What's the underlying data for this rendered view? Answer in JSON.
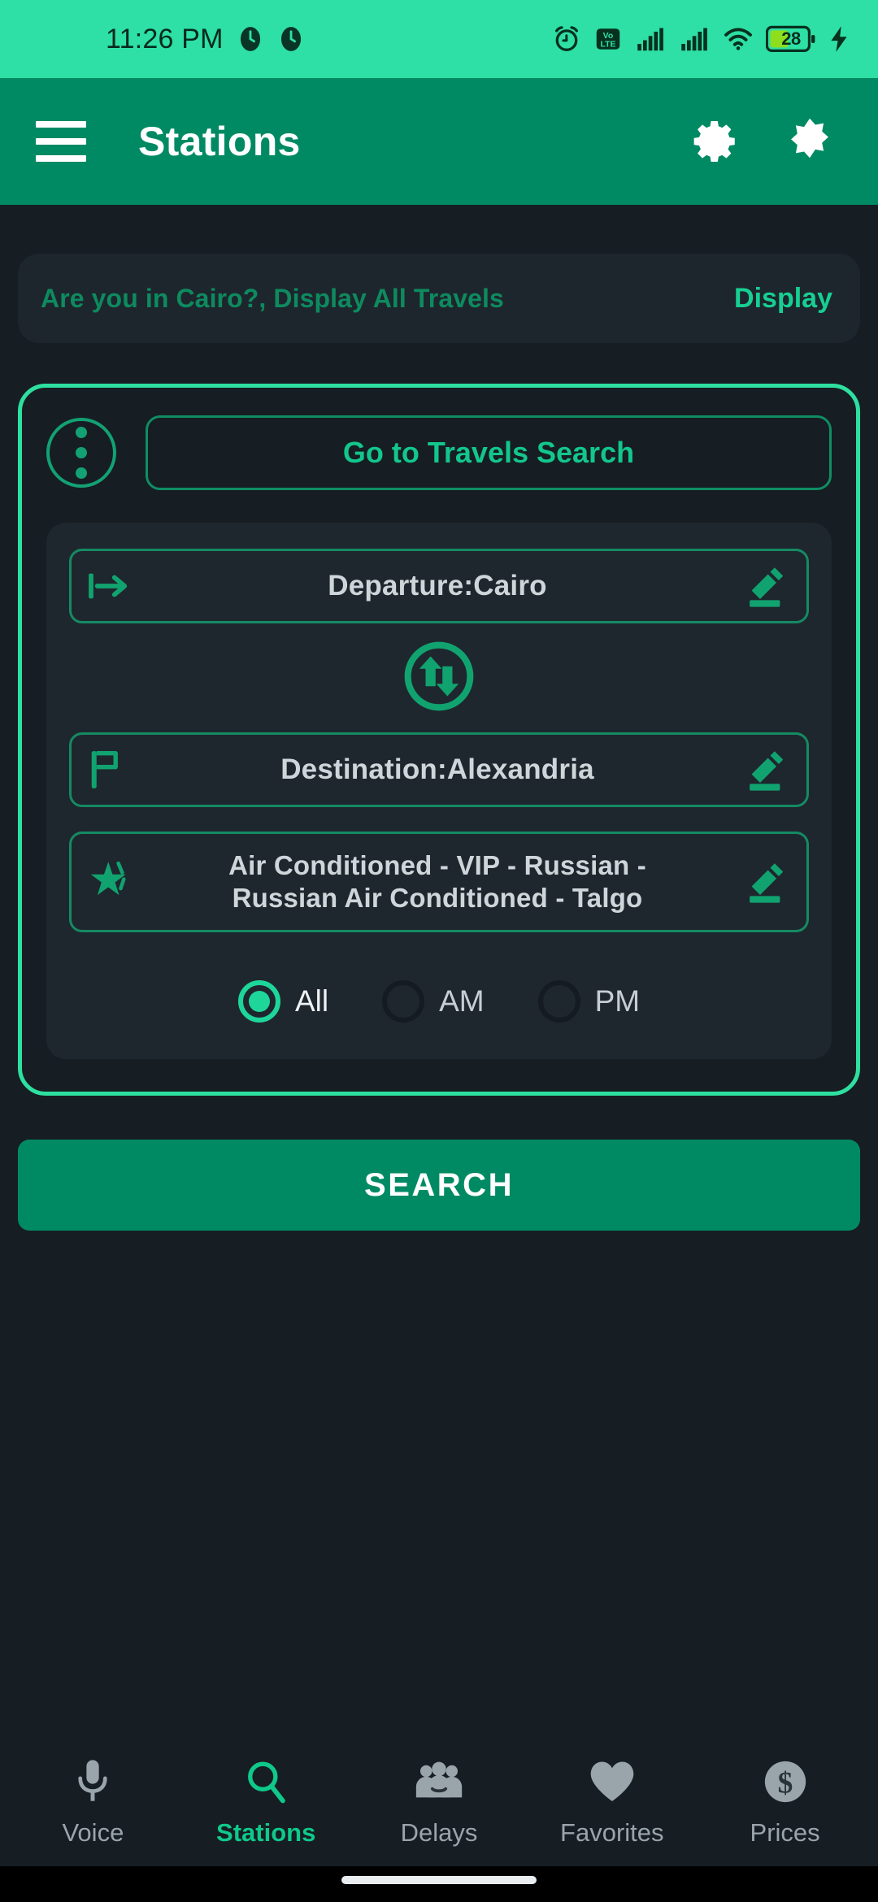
{
  "status_bar": {
    "time": "11:26 PM",
    "battery_percent": "28",
    "icons": [
      "clock-face-icon",
      "clock-face-icon",
      "alarm-icon",
      "volte-icon",
      "signal-bars-icon",
      "signal-bars-icon",
      "wifi-icon",
      "battery-icon",
      "charging-bolt-icon"
    ],
    "volte_top": "Vo",
    "volte_bottom": "LTE",
    "background_color": "#2ee0a5"
  },
  "app_bar": {
    "title": "Stations",
    "menu_icon": "hamburger-menu-icon",
    "settings_icon": "gear-icon",
    "theme_icon": "dark-mode-toggle-icon",
    "background_color": "#008a63"
  },
  "banner": {
    "text": "Are you in Cairo?, Display All Travels",
    "action_label": "Display",
    "text_color": "#0e8a5f",
    "action_color": "#17cf92"
  },
  "search_card": {
    "overflow_icon": "more-vertical-icon",
    "travels_search_label": "Go to Travels Search",
    "border_color": "#2ee0a0",
    "fields": {
      "departure": {
        "label": "Departure:Cairo",
        "icon": "departure-arrow-icon",
        "edit_icon": "edit-pencil-icon"
      },
      "swap": {
        "icon": "swap-vertical-icon"
      },
      "destination": {
        "label": "Destination:Alexandria",
        "icon": "flag-icon",
        "edit_icon": "edit-pencil-icon"
      },
      "train_types": {
        "line1": "Air Conditioned - VIP - Russian -",
        "line2": "Russian Air Conditioned - Talgo",
        "icon": "star-icon",
        "edit_icon": "edit-pencil-icon"
      }
    },
    "period_options": [
      {
        "label": "All",
        "selected": true
      },
      {
        "label": "AM",
        "selected": false
      },
      {
        "label": "PM",
        "selected": false
      }
    ]
  },
  "search_button": {
    "label": "SEARCH",
    "color": "#008a63"
  },
  "bottom_nav": {
    "active_color": "#0fc98a",
    "inactive_color": "#9aa4ab",
    "items": [
      {
        "label": "Voice",
        "icon": "microphone-icon",
        "active": false
      },
      {
        "label": "Stations",
        "icon": "search-icon",
        "active": true
      },
      {
        "label": "Delays",
        "icon": "people-group-icon",
        "active": false
      },
      {
        "label": "Favorites",
        "icon": "heart-icon",
        "active": false
      },
      {
        "label": "Prices",
        "icon": "dollar-circle-icon",
        "active": false
      }
    ]
  }
}
